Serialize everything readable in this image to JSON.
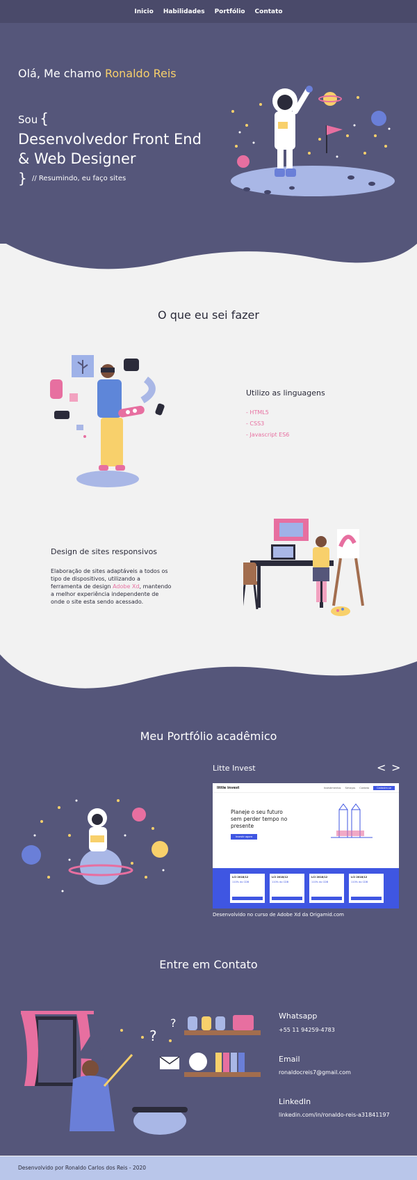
{
  "nav": {
    "items": [
      "Inicio",
      "Habilidades",
      "Portfólio",
      "Contato"
    ]
  },
  "hero": {
    "greeting_prefix": "Olá, Me chamo",
    "greeting_name": "Ronaldo Reis",
    "sou": "Sou",
    "open_brace": "{",
    "title": "Desenvolvedor Front End & Web Designer",
    "close_brace": "}",
    "summary": "// Resumindo, eu faço sites"
  },
  "skills": {
    "title": "O que eu sei fazer",
    "languages_heading": "Utilizo as linguagens",
    "languages": [
      "- HTML5",
      "- CSS3",
      "- Javascript ES6"
    ],
    "design_heading": "Design de sites responsivos",
    "design_text_before": "Elaboração de sites adaptáveis a todos os tipo de dispositivos, utilizando a ferramenta de design",
    "design_tool": "Adobe Xd",
    "design_text_after": ", mantendo a melhor experiência independente de onde o site esta sendo acessado."
  },
  "portfolio": {
    "title": "Meu Portfólio acadêmico",
    "project_name": "Litte Invest",
    "prev_arrow": "<",
    "next_arrow": ">",
    "caption": "Desenvolvido no curso de Adobe Xd da Origamid.com",
    "mock": {
      "logo": "little invest",
      "links": [
        "Investimentos",
        "Serviços",
        "Contato"
      ],
      "cta": "Cadastre-se",
      "hero_text": "Planeje o seu futuro sem perder tempo no presente",
      "button": "Investir agora",
      "cards": [
        {
          "title": "LCI 2018/12",
          "rate": "110% do CDB"
        },
        {
          "title": "LCI 2018/12",
          "rate": "110% do CDB"
        },
        {
          "title": "LCI 2018/12",
          "rate": "110% do CDB"
        },
        {
          "title": "LCI 2018/12",
          "rate": "110% do CDB"
        }
      ]
    }
  },
  "contact": {
    "title": "Entre em Contato",
    "whatsapp_label": "Whatsapp",
    "whatsapp_value": "+55 11 94259-4783",
    "email_label": "Email",
    "email_value": "ronaldocreis7@gmail.com",
    "linkedin_label": "LinkedIn",
    "linkedin_value": "linkedin.com/in/ronaldo-reis-a31841197"
  },
  "footer": {
    "text": "Desenvolvido por Ronaldo Carlos dos Reis - 2020"
  },
  "colors": {
    "purple": "#55567a",
    "nav": "#4a4a6a",
    "accent_yellow": "#f8d06b",
    "accent_pink": "#e76fa0",
    "footer": "#b9c6ea",
    "mock_blue": "#3f56e2"
  }
}
